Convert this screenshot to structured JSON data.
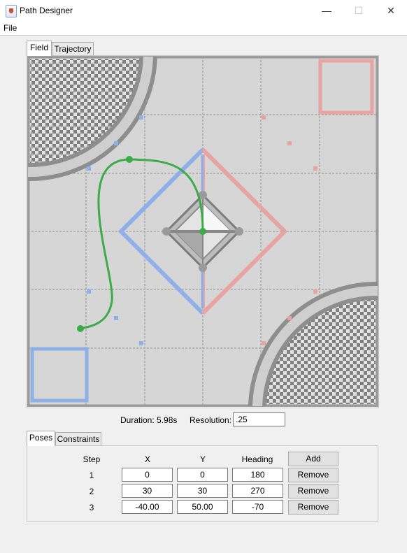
{
  "window": {
    "title": "Path Designer",
    "minimize_glyph": "—",
    "maximize_glyph": "☐",
    "close_glyph": "✕",
    "icon": "java-cup-icon"
  },
  "menu": {
    "items": [
      {
        "label": "File"
      }
    ]
  },
  "top_tabs": [
    {
      "label": "Field",
      "active": true
    },
    {
      "label": "Trajectory",
      "active": false
    }
  ],
  "status": {
    "duration_text": "Duration: 5.98s",
    "resolution_label": "Resolution:",
    "resolution_value": ".25"
  },
  "bottom_tabs": [
    {
      "label": "Poses",
      "active": true
    },
    {
      "label": "Constraints",
      "active": false
    }
  ],
  "poses_table": {
    "headers": {
      "step": "Step",
      "x": "X",
      "y": "Y",
      "heading": "Heading"
    },
    "add_label": "Add",
    "remove_label": "Remove",
    "rows": [
      {
        "step": "1",
        "x": "0",
        "y": "0",
        "heading": "180"
      },
      {
        "step": "2",
        "x": "30",
        "y": "30",
        "heading": "270"
      },
      {
        "step": "3",
        "x": "-40.00",
        "y": "50.00",
        "heading": "-70"
      }
    ]
  },
  "colors": {
    "path": "#3cab4a",
    "blue_alliance": "#8fb0e6",
    "red_alliance": "#e8a3a3",
    "field_bg": "#d9d9d9"
  }
}
